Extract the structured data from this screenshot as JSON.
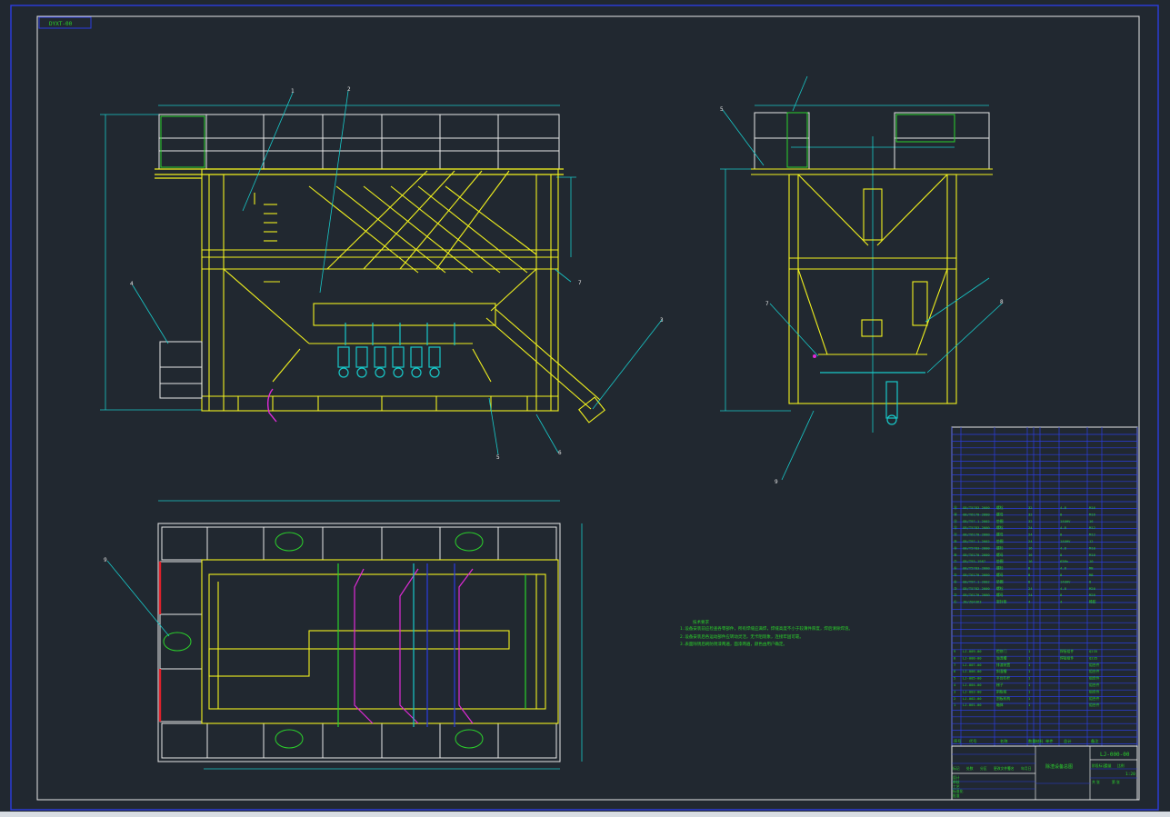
{
  "frame": {
    "drawing_code": "DYXT-00",
    "drawing_number": "LJ-000-00",
    "title_name": "除渣设备总图",
    "scale": "1:20",
    "title_fields": [
      "标记",
      "处数",
      "分区",
      "更改文件号",
      "签名",
      "年月日"
    ],
    "sign_fields": [
      "设计",
      "审核",
      "工艺",
      "标准化",
      "批准"
    ],
    "title_sub": [
      "阶段标记",
      "重量",
      "比例",
      "共  张",
      "第  张"
    ]
  },
  "notes": {
    "heading": "技术要求",
    "lines": [
      "1.设备安装前应检查各零部件，所有焊缝应满焊，焊缝高度不小于较薄件厚度，焊后清除焊渣。",
      "2.设备安装后各运动部件应转动灵活，无卡阻现象，连接牢固可靠。",
      "3.表面除锈后刷防锈漆两遍，面漆两遍，颜色由用户确定。"
    ]
  },
  "callouts": {
    "front": [
      "1",
      "2",
      "3",
      "4",
      "5",
      "6",
      "7"
    ],
    "side": [
      "5",
      "7",
      "8",
      "9"
    ],
    "plan": [
      "9"
    ]
  },
  "bom_upper": [
    {
      "no": "⑮",
      "code": "GB/T5783-2000",
      "name": "螺栓",
      "qty": "32",
      "mat": "4.8",
      "note": "M16"
    },
    {
      "no": "⑭",
      "code": "GB/T6170-2000",
      "name": "螺母",
      "qty": "32",
      "mat": "8",
      "note": "M16"
    },
    {
      "no": "⑬",
      "code": "GB/T97.1-2002",
      "name": "垫圈",
      "qty": "32",
      "mat": "140HV",
      "note": "16"
    },
    {
      "no": "⑫",
      "code": "GB/T5783-2000",
      "name": "螺栓",
      "qty": "24",
      "mat": "4.8",
      "note": "M12"
    },
    {
      "no": "⑪",
      "code": "GB/T6170-2000",
      "name": "螺母",
      "qty": "24",
      "mat": "8",
      "note": "M12"
    },
    {
      "no": "⑩",
      "code": "GB/T97.1-2002",
      "name": "垫圈",
      "qty": "24",
      "mat": "140HV",
      "note": "12"
    },
    {
      "no": "⑨",
      "code": "GB/T5783-2000",
      "name": "螺栓",
      "qty": "16",
      "mat": "4.8",
      "note": "M10"
    },
    {
      "no": "⑧",
      "code": "GB/T6170-2000",
      "name": "螺母",
      "qty": "16",
      "mat": "8",
      "note": "M10"
    },
    {
      "no": "⑦",
      "code": "GB/T93-1987",
      "name": "垫圈",
      "qty": "16",
      "mat": "65Mn",
      "note": "10"
    },
    {
      "no": "⑥",
      "code": "GB/T5783-2000",
      "name": "螺栓",
      "qty": "8",
      "mat": "4.8",
      "note": "M8"
    },
    {
      "no": "⑤",
      "code": "GB/T6170-2000",
      "name": "螺母",
      "qty": "8",
      "mat": "8",
      "note": "M8"
    },
    {
      "no": "④",
      "code": "GB/T97.1-2002",
      "name": "垫圈",
      "qty": "8",
      "mat": "140HV",
      "note": "8"
    },
    {
      "no": "③",
      "code": "GB/T5782-2000",
      "name": "螺栓",
      "qty": "24",
      "mat": "4.8",
      "note": "M20"
    },
    {
      "no": "②",
      "code": "GB/T6170-2000",
      "name": "螺母",
      "qty": "24",
      "mat": "8",
      "note": "M20"
    },
    {
      "no": "①",
      "code": "JB/ZQ4363",
      "name": "密封垫",
      "qty": "4",
      "mat": "4",
      "note": "橡胶"
    }
  ],
  "bom_lower": [
    {
      "no": "9",
      "code": "LJ-009-00",
      "name": "检修门",
      "qty": "1",
      "mat": "焊接组件",
      "note": "Q235"
    },
    {
      "no": "8",
      "code": "LJ-008-00",
      "name": "溢流槽",
      "qty": "1",
      "mat": "焊接组件",
      "note": "Q235"
    },
    {
      "no": "7",
      "code": "LJ-007-00",
      "name": "排渣装置",
      "qty": "1",
      "mat": "",
      "note": "组合件"
    },
    {
      "no": "6",
      "code": "LJ-006-00",
      "name": "斜溜槽",
      "qty": "1",
      "mat": "",
      "note": "组合件"
    },
    {
      "no": "5",
      "code": "LJ-005-00",
      "name": "平台栏杆",
      "qty": "1",
      "mat": "",
      "note": "组合件"
    },
    {
      "no": "4",
      "code": "LJ-004-00",
      "name": "梯子",
      "qty": "1",
      "mat": "",
      "note": "组合件"
    },
    {
      "no": "3",
      "code": "LJ-003-00",
      "name": "斜板组",
      "qty": "1",
      "mat": "",
      "note": "组合件"
    },
    {
      "no": "2",
      "code": "LJ-002-00",
      "name": "刮板机构",
      "qty": "1",
      "mat": "",
      "note": "组合件"
    },
    {
      "no": "1",
      "code": "LJ-001-00",
      "name": "箱体",
      "qty": "1",
      "mat": "",
      "note": "组合件"
    }
  ],
  "bom_headers": [
    "序号",
    "代号",
    "名称",
    "数量",
    "材料",
    "单件",
    "总计",
    "备注"
  ]
}
